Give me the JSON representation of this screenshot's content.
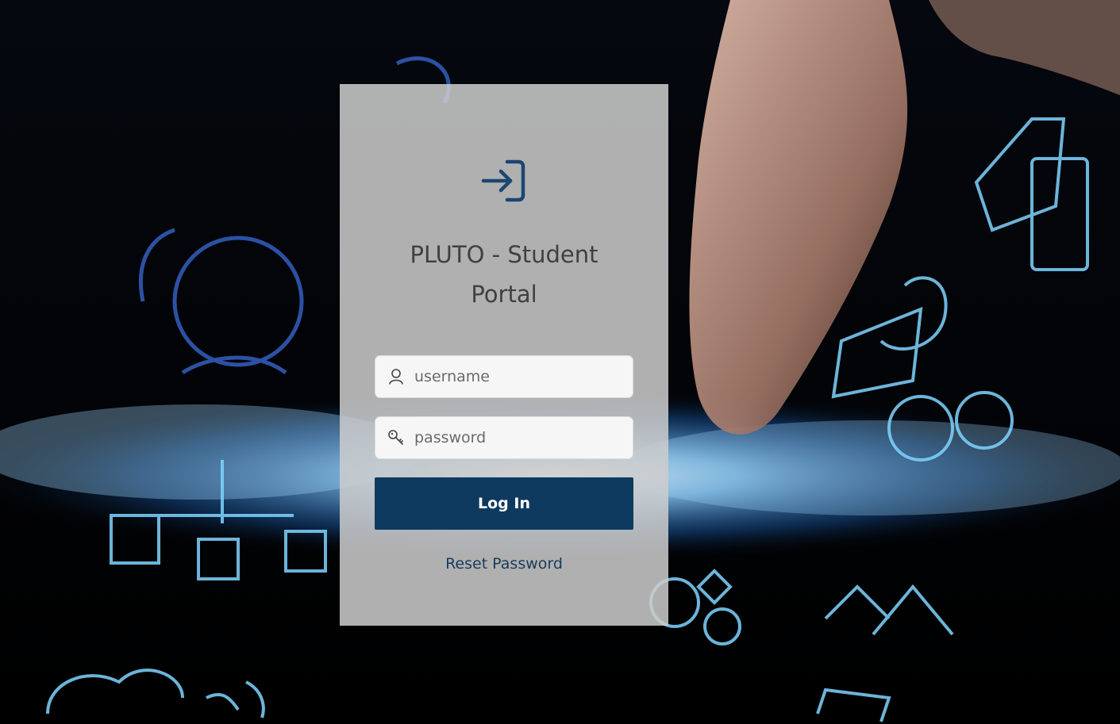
{
  "background": {
    "description_colors": {
      "base": "#000000",
      "glow": "#4aa8ff",
      "sketch": "#7fd4ff"
    }
  },
  "card": {
    "icon": "login-arrow-icon",
    "title_line1": "PLUTO - Student",
    "title_line2": "Portal"
  },
  "form": {
    "username": {
      "placeholder": "username",
      "value": "",
      "icon": "user-icon"
    },
    "password": {
      "placeholder": "password",
      "value": "",
      "icon": "key-icon"
    },
    "login_label": "Log In",
    "reset_label": "Reset Password"
  },
  "colors": {
    "accent": "#0f3a5f",
    "link": "#1a3b5c",
    "card_bg": "#cdcdcd"
  }
}
